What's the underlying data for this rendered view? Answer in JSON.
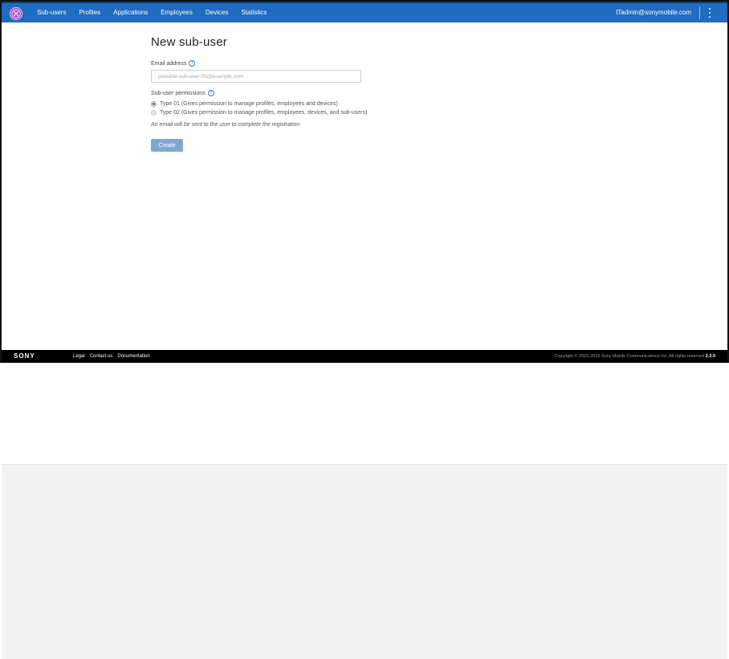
{
  "nav": {
    "items": [
      "Sub-users",
      "Profiles",
      "Applications",
      "Employees",
      "Devices",
      "Statistics"
    ],
    "user_email": "ITadmin@sonymobile.com",
    "accent_color": "#1f6cc1"
  },
  "form": {
    "title": "New sub-user",
    "email_label": "Email address",
    "email_placeholder": "possible-sub-user-05@example.com",
    "email_value": "",
    "permissions_label": "Sub-user permissions",
    "options": [
      {
        "label": "Type 01 (Gives permission to manage profiles, employees and devices)",
        "selected": true
      },
      {
        "label": "Type 02 (Gives permission to manage profiles, employees, devices, and sub-users)",
        "selected": false
      }
    ],
    "note": "An email will be sent to the user to complete the registration",
    "create_label": "Create"
  },
  "footer": {
    "brand": "SONY",
    "links": [
      "Legal",
      "Contact us",
      "Documentation"
    ],
    "copyright": "Copyright © 2015-2016 Sony Mobile Communications Inc. All rights reserved",
    "version": "2.2.0"
  }
}
